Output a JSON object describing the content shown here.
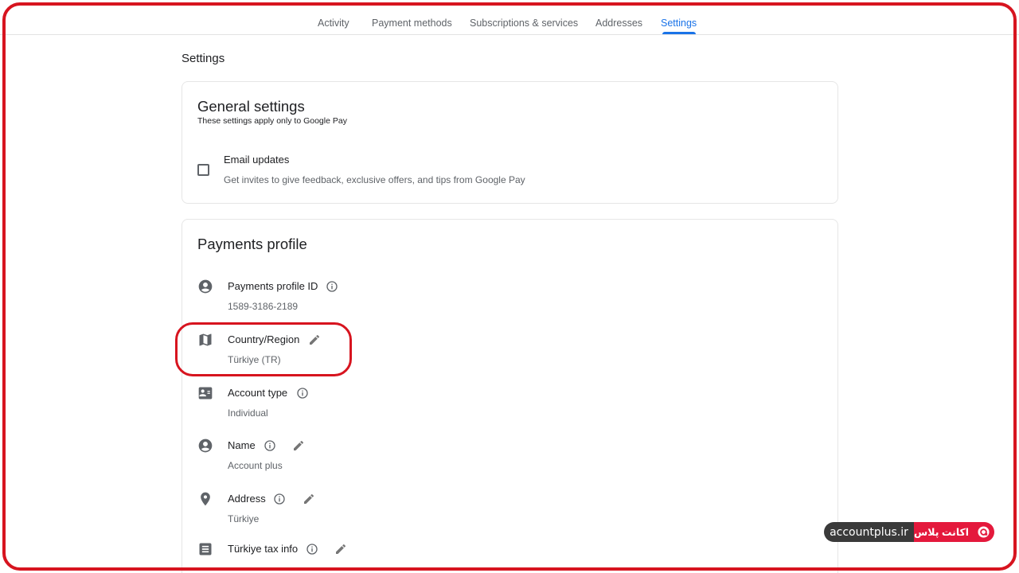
{
  "nav": {
    "tabs": [
      {
        "label": "Activity"
      },
      {
        "label": "Payment methods"
      },
      {
        "label": "Subscriptions & services"
      },
      {
        "label": "Addresses"
      },
      {
        "label": "Settings"
      }
    ],
    "active_tab": "Settings"
  },
  "page": {
    "title": "Settings"
  },
  "general": {
    "title": "General settings",
    "subtitle": "These settings apply only to Google Pay",
    "email_updates": {
      "title": "Email updates",
      "description": "Get invites to give feedback, exclusive offers, and tips from Google Pay",
      "checked": false
    }
  },
  "payments": {
    "title": "Payments profile",
    "rows": [
      {
        "label": "Payments profile ID",
        "value": "1589-3186-2189",
        "icon": "account-circle-icon",
        "info": true,
        "edit": false
      },
      {
        "label": "Country/Region",
        "value": "Türkiye (TR)",
        "icon": "map-icon",
        "info": false,
        "edit": true
      },
      {
        "label": "Account type",
        "value": "Individual",
        "icon": "contact-card-icon",
        "info": true,
        "edit": false
      },
      {
        "label": "Name",
        "value": "Account plus",
        "icon": "account-circle-icon",
        "info": true,
        "edit": true
      },
      {
        "label": "Address",
        "value": "Türkiye",
        "icon": "location-pin-icon",
        "info": true,
        "edit": true
      },
      {
        "label": "Türkiye tax info",
        "value": "",
        "icon": "document-icon",
        "info": true,
        "edit": true
      }
    ]
  },
  "watermark": {
    "domain": "accountplus.ir",
    "brand": "اکانت پلاس"
  },
  "colors": {
    "accent": "#1a73e8",
    "highlight": "#d7141f",
    "text_secondary": "#5f6368"
  }
}
